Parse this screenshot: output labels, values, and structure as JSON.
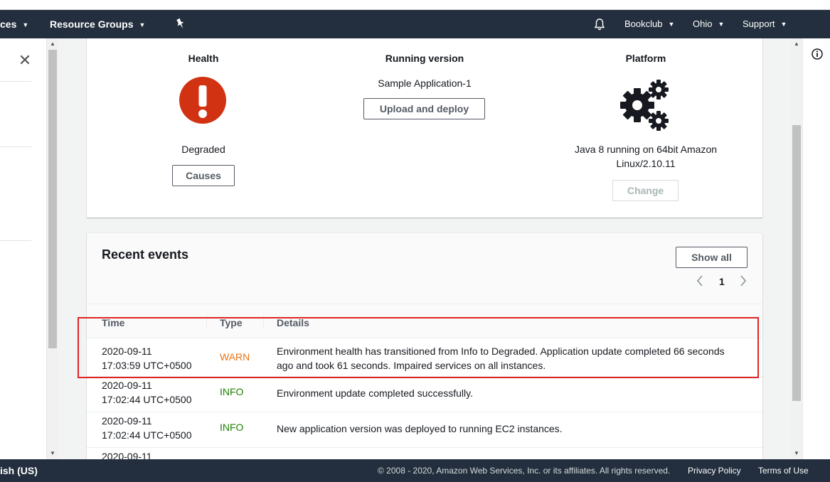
{
  "topnav": {
    "services_label": "ces",
    "resource_groups_label": "Resource Groups",
    "account_label": "Bookclub",
    "region_label": "Ohio",
    "support_label": "Support"
  },
  "overview": {
    "health": {
      "title": "Health",
      "status": "Degraded",
      "causes_label": "Causes"
    },
    "running_version": {
      "title": "Running version",
      "value": "Sample Application-1",
      "upload_label": "Upload and deploy"
    },
    "platform": {
      "title": "Platform",
      "value_line1": "Java 8 running on 64bit Amazon",
      "value_line2": "Linux/2.10.11",
      "change_label": "Change"
    }
  },
  "events": {
    "title": "Recent events",
    "show_all_label": "Show all",
    "page_number": "1",
    "columns": {
      "time": "Time",
      "type": "Type",
      "details": "Details"
    },
    "rows": [
      {
        "date": "2020-09-11",
        "time": "17:03:59 UTC+0500",
        "type": "WARN",
        "details_line1": "Environment health has transitioned from Info to Degraded. Application update completed 66 seconds",
        "details_line2": "ago and took 61 seconds. Impaired services on all instances."
      },
      {
        "date": "2020-09-11",
        "time": "17:02:44 UTC+0500",
        "type": "INFO",
        "details_line1": "Environment update completed successfully.",
        "details_line2": ""
      },
      {
        "date": "2020-09-11",
        "time": "17:02:44 UTC+0500",
        "type": "INFO",
        "details_line1": "New application version was deployed to running EC2 instances.",
        "details_line2": ""
      },
      {
        "date": "2020-09-11",
        "time": "",
        "type": "",
        "details_line1": "",
        "details_line2": ""
      }
    ]
  },
  "footer": {
    "language": "ish (US)",
    "copyright": "© 2008 - 2020, Amazon Web Services, Inc. or its affiliates. All rights reserved.",
    "privacy": "Privacy Policy",
    "terms": "Terms of Use"
  },
  "colors": {
    "nav_bg": "#232f3e",
    "health_red": "#d13212",
    "warn": "#ec7211",
    "info": "#1d8102",
    "highlight": "#e02424"
  }
}
